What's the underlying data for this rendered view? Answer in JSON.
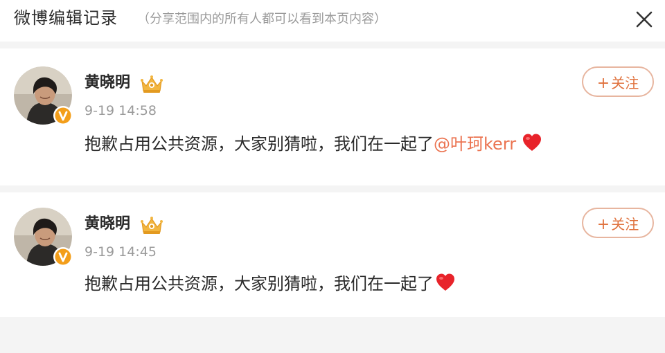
{
  "header": {
    "title": "微博编辑记录",
    "subtitle": "（分享范围内的所有人都可以看到本页内容）"
  },
  "posts": [
    {
      "author": "黄晓明",
      "time": "9-19 14:58",
      "text": "抱歉占用公共资源，大家别猜啦，我们在一起了",
      "mention": "@叶珂kerr",
      "follow_plus": "+",
      "follow_label": "关注"
    },
    {
      "author": "黄晓明",
      "time": "9-19 14:45",
      "text": "抱歉占用公共资源，大家别猜啦，我们在一起了",
      "mention": "",
      "follow_plus": "+",
      "follow_label": "关注"
    }
  ],
  "colors": {
    "accent_orange": "#eb7350",
    "follow_border": "#e7b59f",
    "muted_gray": "#9a9a9a",
    "divider": "#f4f4f4",
    "heart_red": "#e8232a",
    "verified_orange": "#f39e1a"
  },
  "icons": {
    "close": "close-icon",
    "crown": "vip-crown-icon",
    "verified": "verified-v-badge-icon",
    "heart": "heart-emoji-icon"
  }
}
